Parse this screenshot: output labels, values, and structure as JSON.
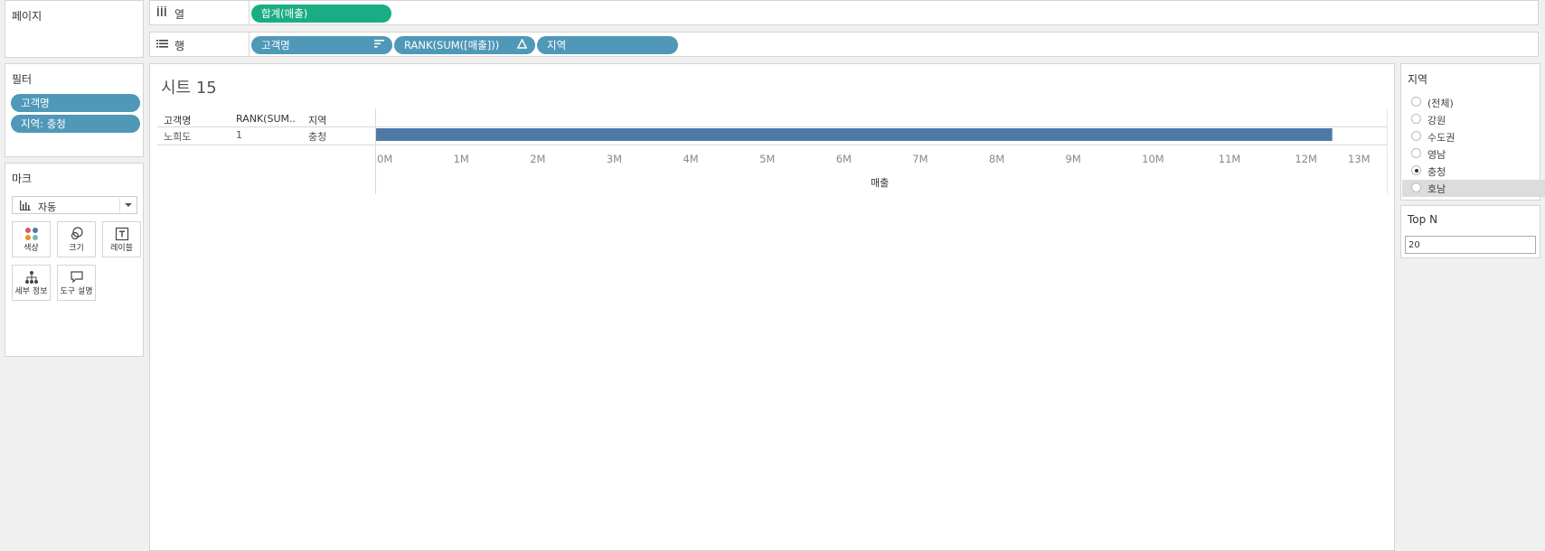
{
  "pages": {
    "title": "페이지"
  },
  "columns_shelf": {
    "icon": "columns-icon",
    "label": "열",
    "pills": [
      {
        "label": "합계(매출)",
        "color": "#1aad84"
      }
    ]
  },
  "rows_shelf": {
    "icon": "rows-icon",
    "label": "행",
    "pills": [
      {
        "label": "고객명",
        "trail_icon": "sort-descending-icon"
      },
      {
        "label": "RANK(SUM([매출]))",
        "trail_icon": "delta-icon"
      },
      {
        "label": "지역"
      }
    ]
  },
  "filters": {
    "title": "필터",
    "items": [
      {
        "label": "고객명"
      },
      {
        "label": "지역: 충청"
      }
    ]
  },
  "marks": {
    "title": "마크",
    "type_value": "자동",
    "type_icon": "bar-chart-icon",
    "buttons": [
      {
        "label": "색상",
        "icon": "color-icon"
      },
      {
        "label": "크기",
        "icon": "size-icon"
      },
      {
        "label": "레이블",
        "icon": "label-icon"
      },
      {
        "label": "세부 정보",
        "icon": "detail-icon"
      },
      {
        "label": "도구 설명",
        "icon": "tooltip-icon"
      }
    ]
  },
  "sheet": {
    "title": "시트 15",
    "headers": [
      "고객명",
      "RANK(SUM..",
      "지역"
    ],
    "row": [
      "노희도",
      "1",
      "충청"
    ]
  },
  "chart_data": {
    "type": "bar",
    "orientation": "horizontal",
    "categories": [
      "노희도"
    ],
    "values": [
      12.5
    ],
    "unit": "M",
    "xlabel": "매출",
    "xlim": [
      0,
      13
    ],
    "ticks": [
      "0M",
      "1M",
      "2M",
      "3M",
      "4M",
      "5M",
      "6M",
      "7M",
      "8M",
      "9M",
      "10M",
      "11M",
      "12M",
      "13M"
    ],
    "bar_color": "#4e79a7"
  },
  "region_filter": {
    "title": "지역",
    "options": [
      "(전체)",
      "강원",
      "수도권",
      "영남",
      "충청",
      "호남"
    ],
    "selected": "충청",
    "hovered": "호남"
  },
  "topn": {
    "title": "Top N",
    "value": "20"
  }
}
